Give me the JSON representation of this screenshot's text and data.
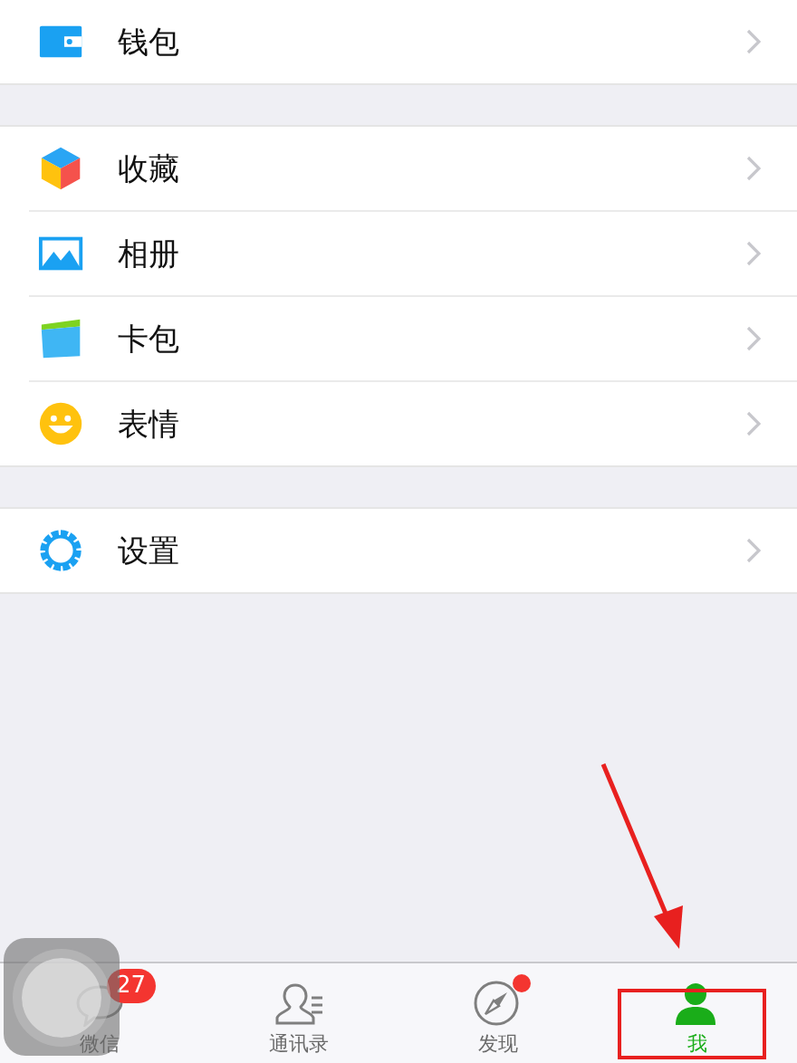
{
  "groups": [
    {
      "items": [
        {
          "label": "钱包"
        }
      ]
    },
    {
      "items": [
        {
          "label": "收藏"
        },
        {
          "label": "相册"
        },
        {
          "label": "卡包"
        },
        {
          "label": "表情"
        }
      ]
    },
    {
      "items": [
        {
          "label": "设置"
        }
      ]
    }
  ],
  "tab_bar": {
    "tabs": [
      {
        "label": "微信",
        "badge": "27",
        "selected": false
      },
      {
        "label": "通讯录",
        "selected": false
      },
      {
        "label": "发现",
        "dot": true,
        "selected": false
      },
      {
        "label": "我",
        "selected": true
      }
    ]
  },
  "annotation": {
    "shown": true
  },
  "assistive_touch": {
    "shown": true
  }
}
